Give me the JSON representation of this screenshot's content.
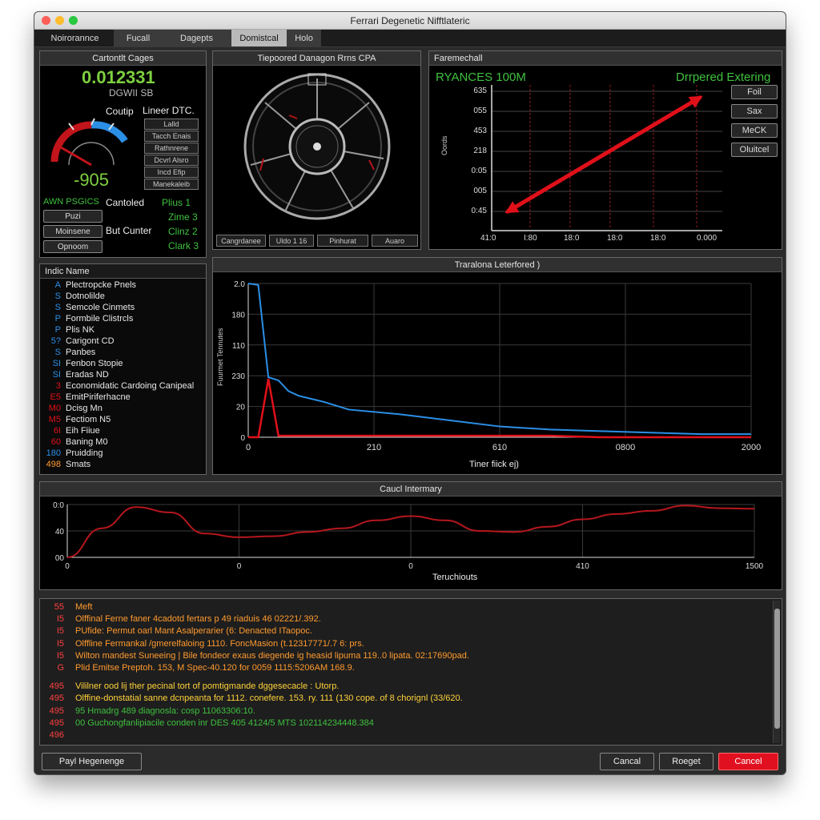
{
  "window": {
    "title": "Ferrari Degenetic Nifftlateric"
  },
  "menu": [
    "Noirorannce",
    "Fucall",
    "Dagepts",
    "Domistcal",
    "Holo"
  ],
  "colors": {
    "accent_red": "#e0101a",
    "green": "#3ec13e",
    "blue": "#2b8fe6",
    "amber": "#ff9a2e"
  },
  "p1": {
    "title": "Cartontlt Cages",
    "readout": "0.012331",
    "subreadout": "DGWII SB",
    "label_left": "Coutip",
    "label_right": "Lineer DTC.",
    "gauge_value": "-905",
    "mini_buttons": [
      "Lalld",
      "Tacch Enais",
      "Rathnrene",
      "Dcvrl Alsro",
      "Incd Efip",
      "Manekaleib"
    ],
    "status_left": "AWN PSGICS",
    "status_left2": "Cantoled",
    "status_right": [
      "Plius 1",
      "Zime 3",
      "Clinz 2",
      "Clark 3"
    ],
    "buttons": [
      "Puzi",
      "Moinsene",
      "Opnoom"
    ],
    "but_label": "But Cunter"
  },
  "p2": {
    "title": "Tiepoored Danagon Rrns CPA",
    "buttons": [
      "Cangrdanee",
      "Uldo 1 16",
      "Pinhurat",
      "Auaro"
    ]
  },
  "p3": {
    "title": "Faremechall",
    "label_left": "RYANCES 100M",
    "label_right": "Drrpered Extering",
    "ylabel": "Oords",
    "yticks": [
      "635",
      "055",
      "453",
      "218",
      "0:05",
      "005",
      "0:45"
    ],
    "xticks": [
      "41:0",
      "I:80",
      "18:0",
      "18:0",
      "18:0",
      "0.000"
    ],
    "side_buttons": [
      "Foil",
      "Sax",
      "MeCK",
      "Oluitcel"
    ]
  },
  "list": {
    "header": "Indic Name",
    "items": [
      {
        "num": "A",
        "name": "Plectropcke Pnels",
        "color": "#2b8fe6"
      },
      {
        "num": "S",
        "name": "Dotnolilde",
        "color": "#2b8fe6"
      },
      {
        "num": "S",
        "name": "Semcole Cinmets",
        "color": "#2b8fe6"
      },
      {
        "num": "P",
        "name": "Formbile Clistrcls",
        "color": "#2b8fe6"
      },
      {
        "num": "P",
        "name": "Plis NK",
        "color": "#2b8fe6"
      },
      {
        "num": "5?",
        "name": "Carigont CD",
        "color": "#2b8fe6"
      },
      {
        "num": "S",
        "name": "Panbes",
        "color": "#2b8fe6"
      },
      {
        "num": "SI",
        "name": "Fenbon Stopie",
        "color": "#2b8fe6"
      },
      {
        "num": "SI",
        "name": "Eradas ND",
        "color": "#2b8fe6"
      },
      {
        "num": "3",
        "name": "Economidatic Cardoing Canipeal",
        "color": "#e0101a"
      },
      {
        "num": "E5",
        "name": "EmitPiriferhacne",
        "color": "#e0101a"
      },
      {
        "num": "M0",
        "name": "Dcisg Mn",
        "color": "#e0101a"
      },
      {
        "num": "M5",
        "name": "Fectiom N5",
        "color": "#e0101a"
      },
      {
        "num": "6I",
        "name": "Eih Fiiue",
        "color": "#e0101a"
      },
      {
        "num": "60",
        "name": "Baning M0",
        "color": "#e0101a"
      },
      {
        "num": "180",
        "name": "Pruidding",
        "color": "#2b8fe6"
      },
      {
        "num": "498",
        "name": "Smats",
        "color": "#ff9a2e"
      }
    ]
  },
  "chart_data": [
    {
      "type": "line",
      "title": "Traralona Leterfored )",
      "xlabel": "Tiner fiick ej)",
      "ylabel": "Fuurmet Tennutes",
      "xticks": [
        "0",
        "210",
        "610",
        "0800",
        "2000"
      ],
      "yticks": [
        "2.0",
        "180",
        "110",
        "230",
        "20",
        "0"
      ],
      "x": [
        0,
        2,
        4,
        6,
        8,
        10,
        15,
        20,
        30,
        40,
        50,
        60,
        70,
        80,
        90,
        100
      ],
      "series": [
        {
          "name": "",
          "color": "#2b8fe6",
          "values": [
            1.0,
            0.99,
            0.39,
            0.37,
            0.3,
            0.27,
            0.23,
            0.18,
            0.15,
            0.11,
            0.07,
            0.05,
            0.04,
            0.03,
            0.02,
            0.02
          ]
        },
        {
          "name": "",
          "color": "#e0101a",
          "values": [
            0.0,
            0.0,
            0.38,
            0.01,
            0.01,
            0.01,
            0.01,
            0.01,
            0.01,
            0.01,
            0.01,
            0.01,
            0.0,
            0.0,
            0.0,
            0.0
          ]
        }
      ]
    },
    {
      "type": "line",
      "title": "Caucl Intermary",
      "xlabel": "Teruchiouts",
      "xticks": [
        "0",
        "0",
        "0",
        "410",
        "1500"
      ],
      "yticks": [
        "0:0",
        "40",
        "00"
      ],
      "x": [
        0,
        0.5,
        1,
        1.5,
        2,
        2.5,
        3,
        3.5,
        4,
        4.5,
        5,
        5.5,
        6,
        6.5,
        7,
        7.5,
        8,
        8.5,
        9,
        9.5,
        10
      ],
      "series": [
        {
          "name": "",
          "color": "#b5171d",
          "values": [
            0.0,
            0.55,
            0.95,
            0.85,
            0.45,
            0.38,
            0.4,
            0.48,
            0.55,
            0.7,
            0.78,
            0.7,
            0.5,
            0.48,
            0.58,
            0.72,
            0.82,
            0.88,
            0.98,
            0.93,
            0.92
          ]
        }
      ]
    },
    {
      "type": "line",
      "title": "",
      "x": [
        0,
        1
      ],
      "series": [
        {
          "name": "",
          "color": "#e0101a",
          "values": [
            0.1,
            0.9
          ]
        }
      ]
    }
  ],
  "log": {
    "lines": [
      {
        "ln": "55",
        "text": "Meft",
        "color": "#ff9a2e"
      },
      {
        "ln": "I5",
        "text": "Olffinal Ferne faner 4cadotd fertars p 49 riaduis 46 02221/.392.",
        "color": "#ff9a2e"
      },
      {
        "ln": "I5",
        "text": "PUfide: Permut oarl Mant Asalperarier (6: Denacted ITaopoc.",
        "color": "#ff9a2e"
      },
      {
        "ln": "I5",
        "text": "Olffline Fermankal /gmerelfaloing 1110. FoncMasion (t.12317771/.7 6: prs.",
        "color": "#ff9a2e"
      },
      {
        "ln": "I5",
        "text": "Wilton mandest Suneeing | Bile fondeor exaus diegende ig heasid lipuma 119..0 lipata. 02:17690pad.",
        "color": "#ff9a2e"
      },
      {
        "ln": "G",
        "text": "Plid Emitse Preptoh. 153, M Spec-40.120 for 0059 1115:5206AM 168.9.",
        "color": "#ff9a2e"
      },
      {
        "ln": "495",
        "text": "Vililner ood lij ther pecinal tort of pomtigmande dggesecacle : Utorp.",
        "color": "#ffd23a"
      },
      {
        "ln": "495",
        "text": "Olffine-donstatial sanne dcnpeanta for 1112. conefere. 153. ry. 111 (130 cope. of 8 chorignl (33/620.",
        "color": "#ffd23a"
      },
      {
        "ln": "495",
        "text": "95 Hmadrg 489 diagnosla: cosp 11063306:10.",
        "color": "#3ec13e"
      },
      {
        "ln": "495",
        "text": "00 Guchongfanlipiacile conden inr DES 405 4124/5 MTS 102114234448.384",
        "color": "#3ec13e"
      },
      {
        "ln": "496",
        "text": "",
        "color": "#3ec13e"
      }
    ]
  },
  "footer": {
    "left": "Payl Hegenenge",
    "cancel1": "Cancal",
    "reset": "Roeget",
    "cancel2": "Cancel"
  }
}
